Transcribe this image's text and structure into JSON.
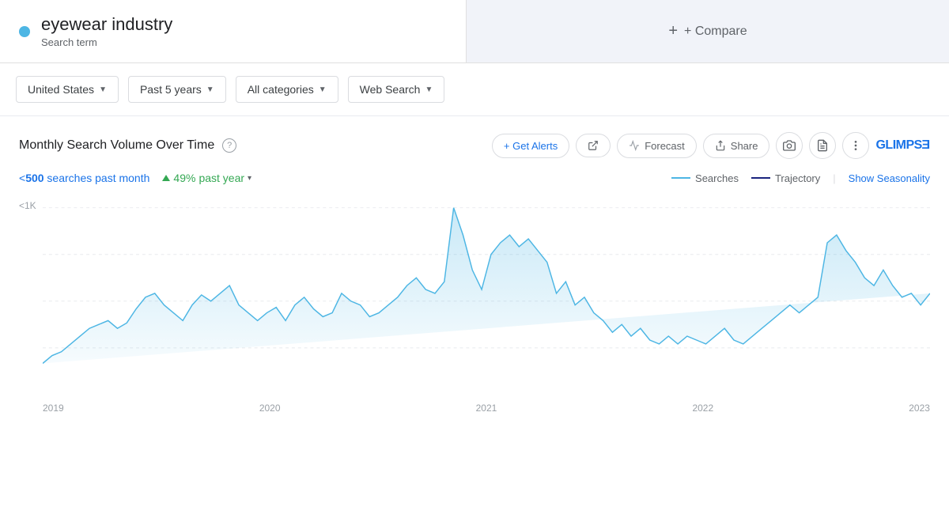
{
  "header": {
    "search_term_name": "eyewear industry",
    "search_term_sub": "Search term",
    "dot_color": "#4db6e4",
    "compare_label": "+ Compare"
  },
  "filters": {
    "region": "United States",
    "time_range": "Past 5 years",
    "categories": "All categories",
    "search_type": "Web Search"
  },
  "chart": {
    "title": "Monthly Search Volume Over Time",
    "help_tooltip": "?",
    "actions": {
      "alerts_label": "+ Get Alerts",
      "forecast_label": "Forecast",
      "share_label": "Share"
    },
    "glimpse_logo": "GLIMPSE",
    "stats": {
      "searches_past_month_prefix": "<",
      "searches_value": "500",
      "searches_suffix": " searches past month",
      "growth_value": "49%",
      "growth_suffix": " past year"
    },
    "legend": {
      "searches_label": "Searches",
      "trajectory_label": "Trajectory",
      "show_seasonality_label": "Show Seasonality"
    },
    "y_label": "<1K",
    "x_labels": [
      "2019",
      "2020",
      "2021",
      "2022",
      "2023"
    ]
  }
}
